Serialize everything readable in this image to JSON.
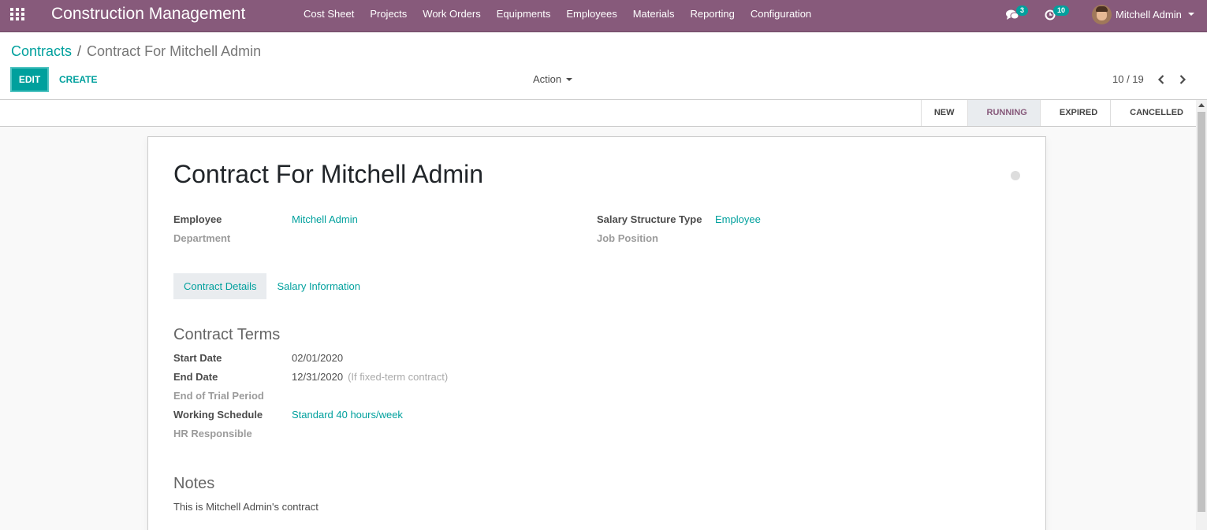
{
  "navbar": {
    "app_title": "Construction Management",
    "menu": [
      "Cost Sheet",
      "Projects",
      "Work Orders",
      "Equipments",
      "Employees",
      "Materials",
      "Reporting",
      "Configuration"
    ],
    "messages_count": "3",
    "activities_count": "10",
    "user_name": "Mitchell Admin"
  },
  "breadcrumb": {
    "parent": "Contracts",
    "separator": "/",
    "current": "Contract For Mitchell Admin"
  },
  "toolbar": {
    "edit_label": "EDIT",
    "create_label": "CREATE",
    "action_label": "Action",
    "pager": "10 / 19"
  },
  "stages": [
    "NEW",
    "RUNNING",
    "EXPIRED",
    "CANCELLED"
  ],
  "active_stage": "RUNNING",
  "record": {
    "title": "Contract For Mitchell Admin",
    "employee_label": "Employee",
    "employee_value": "Mitchell Admin",
    "department_label": "Department",
    "salary_structure_label": "Salary Structure Type",
    "salary_structure_value": "Employee",
    "job_position_label": "Job Position"
  },
  "tabs": [
    "Contract Details",
    "Salary Information"
  ],
  "contract_terms": {
    "title": "Contract Terms",
    "start_date_label": "Start Date",
    "start_date_value": "02/01/2020",
    "end_date_label": "End Date",
    "end_date_value": "12/31/2020",
    "end_date_hint": "(If fixed-term contract)",
    "trial_label": "End of Trial Period",
    "schedule_label": "Working Schedule",
    "schedule_value": "Standard 40 hours/week",
    "hr_label": "HR Responsible"
  },
  "notes": {
    "title": "Notes",
    "text": "This is Mitchell Admin's contract"
  },
  "colors": {
    "brand": "#875a7b",
    "accent": "#00a09d"
  }
}
